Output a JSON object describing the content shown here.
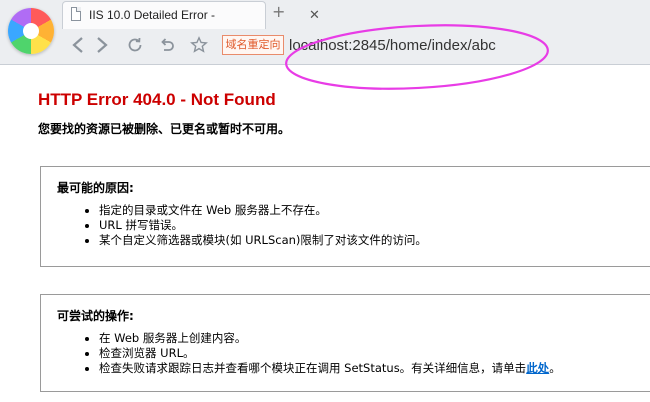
{
  "tab": {
    "title": "IIS 10.0 Detailed Error -",
    "close_icon": "close-icon",
    "new_tab_icon": "plus-icon"
  },
  "toolbar": {
    "redirect_label": "域名重定向",
    "url": "localhost:2845/home/index/abc"
  },
  "annotation": {
    "color": "#e83ce6"
  },
  "error": {
    "title": "HTTP Error 404.0 - Not Found",
    "subtitle": "您要找的资源已被删除、已更名或暂时不可用。",
    "title_color": "#cc0000"
  },
  "causes": {
    "heading": "最可能的原因:",
    "items": [
      "指定的目录或文件在 Web 服务器上不存在。",
      "URL 拼写错误。",
      "某个自定义筛选器或模块(如 URLScan)限制了对该文件的访问。"
    ]
  },
  "actions": {
    "heading": "可尝试的操作:",
    "items": [
      "在 Web 服务器上创建内容。",
      "检查浏览器 URL。"
    ],
    "last_item_prefix": "检查失败请求跟踪日志并查看哪个模块正在调用 SetStatus。有关详细信息，请单击",
    "last_item_link": "此处",
    "last_item_suffix": "。"
  }
}
